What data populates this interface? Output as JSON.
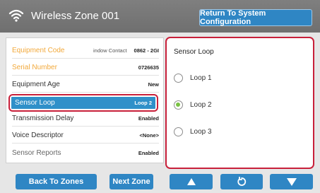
{
  "header": {
    "title": "Wireless Zone 001",
    "return_label": "Return To System Configuration",
    "icon": "wifi-icon"
  },
  "details": {
    "rows": [
      {
        "label": "Equipment Code",
        "middle": "indow Contact",
        "value": "0862 - 2GI"
      },
      {
        "label": "Serial Number",
        "value": "0726635"
      },
      {
        "label": "Equipment Age",
        "value": "New"
      },
      {
        "label": "Sensor Loop",
        "value": "Loop 2"
      },
      {
        "label": "Transmission Delay",
        "value": "Enabled"
      },
      {
        "label": "Voice Descriptor",
        "value": "<None>"
      },
      {
        "label": "Sensor Reports",
        "value": "Enabled"
      }
    ]
  },
  "sensor_loop": {
    "title": "Sensor Loop",
    "options": [
      {
        "label": "Loop 1",
        "selected": false
      },
      {
        "label": "Loop 2",
        "selected": true
      },
      {
        "label": "Loop 3",
        "selected": false
      }
    ]
  },
  "footer": {
    "back_label": "Back To Zones",
    "next_label": "Next Zone",
    "up_icon": "arrow-up-icon",
    "refresh_icon": "refresh-icon",
    "down_icon": "arrow-down-icon"
  },
  "colors": {
    "accent": "#2f86c4",
    "selected_row": "#2f90c9",
    "highlight_border": "#c8203a",
    "orange_label": "#f2a93b",
    "radio_on": "#79c142"
  }
}
